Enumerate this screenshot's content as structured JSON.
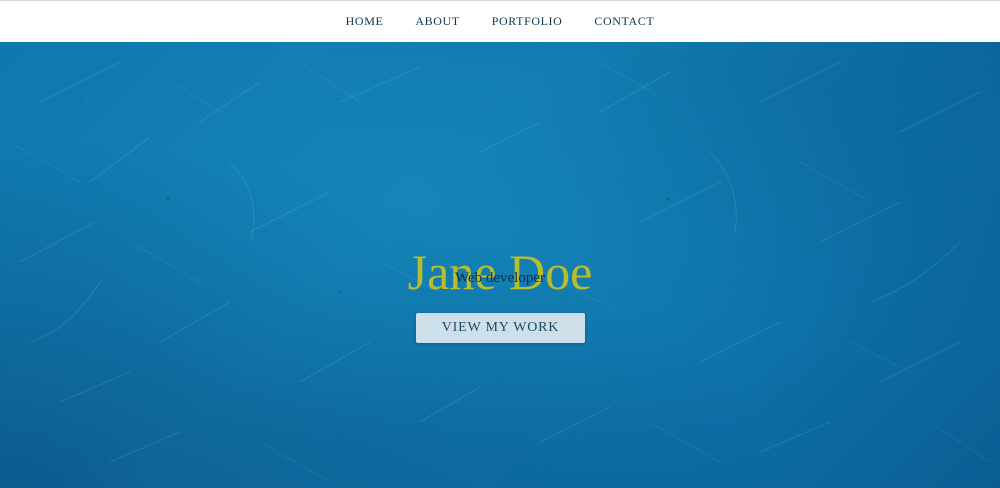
{
  "nav": {
    "items": [
      {
        "label": "HOME"
      },
      {
        "label": "ABOUT"
      },
      {
        "label": "PORTFOLIO"
      },
      {
        "label": "CONTACT"
      }
    ]
  },
  "hero": {
    "name": "Jane Doe",
    "subtitle": "Web developer",
    "cta_label": "VIEW MY WORK",
    "background_icon": "scratched-blue-texture"
  },
  "colors": {
    "nav_background": "#ffffff",
    "nav_text": "#0b3550",
    "hero_blue": "#1583b8",
    "name_text": "#b7bd2c",
    "subtitle_text": "#0a2e45",
    "button_background": "#cde0e9",
    "button_text": "#1e4a66"
  }
}
